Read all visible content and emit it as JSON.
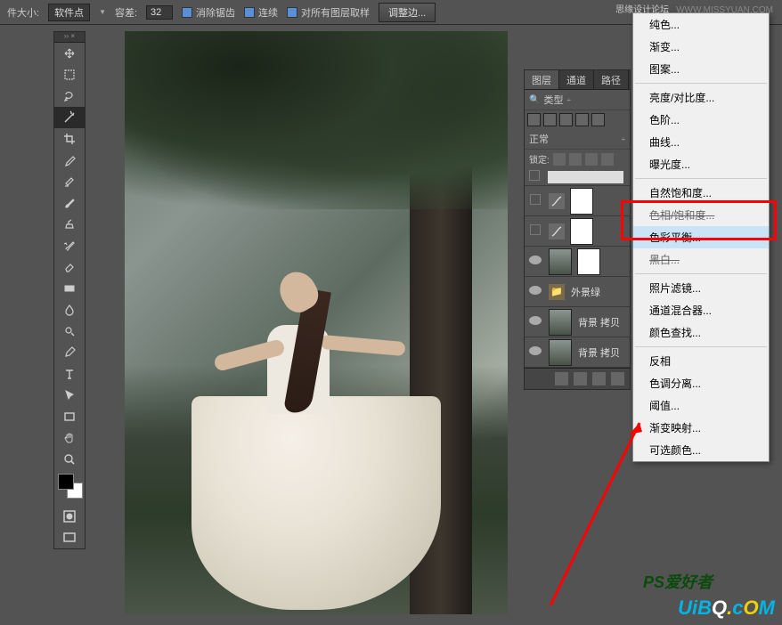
{
  "options_bar": {
    "size_label": "件大小:",
    "size_mode": "软件点",
    "tolerance_label": "容差:",
    "tolerance_value": "32",
    "anti_alias": "消除锯齿",
    "contiguous": "连续",
    "all_layers": "对所有图层取样",
    "refine_edge": "调整边...",
    "icon": "magic-wand"
  },
  "toolbox": {
    "tools": [
      "move",
      "marquee",
      "lasso",
      "magic-wand",
      "crop",
      "eyedropper",
      "healing-brush",
      "brush",
      "clone-stamp",
      "history-brush",
      "eraser",
      "gradient",
      "blur",
      "dodge",
      "pen",
      "type",
      "path-select",
      "rectangle",
      "hand",
      "zoom"
    ],
    "selected": "magic-wand",
    "header": "››  ×"
  },
  "layers_panel": {
    "tabs": [
      "图层",
      "通道",
      "路径"
    ],
    "active_tab": "图层",
    "filter_label": "类型",
    "blend_mode": "正常",
    "lock_label": "锁定:",
    "layers": [
      {
        "visible": false,
        "type": "adj",
        "adj_icon": "curves",
        "mask": true,
        "thin": true,
        "name": ""
      },
      {
        "visible": false,
        "type": "adj",
        "adj_icon": "curves",
        "mask": true,
        "name": ""
      },
      {
        "visible": false,
        "type": "adj",
        "adj_icon": "balance",
        "mask": true,
        "name": ""
      },
      {
        "visible": true,
        "type": "image",
        "mask": true,
        "name": ""
      },
      {
        "visible": true,
        "type": "group",
        "name": "外景绿"
      },
      {
        "visible": true,
        "type": "image",
        "name": "背景 拷贝"
      },
      {
        "visible": true,
        "type": "image",
        "name": "背景 拷贝"
      }
    ],
    "footer_icons": [
      "link",
      "fx",
      "mask",
      "adj",
      "group",
      "new",
      "trash"
    ]
  },
  "adjustment_menu": {
    "groups": [
      [
        "纯色...",
        "渐变...",
        "图案..."
      ],
      [
        "亮度/对比度...",
        "色阶...",
        "曲线...",
        "曝光度..."
      ],
      [
        "自然饱和度...",
        "色相/饱和度...",
        "色彩平衡...",
        "黑白..."
      ],
      [
        "照片滤镜...",
        "通道混合器...",
        "颜色查找..."
      ],
      [
        "反相",
        "色调分离...",
        "阈值...",
        "渐变映射...",
        "可选颜色..."
      ]
    ],
    "highlighted": "色彩平衡...",
    "strikethrough": [
      "色相/饱和度...",
      "黑白..."
    ]
  },
  "watermarks": {
    "top_cn": "思缘设计论坛",
    "top_url": "WWW.MISSYUAN.COM",
    "ps_text": "PS爱好者",
    "uibq": "UiBQ.cOM"
  }
}
